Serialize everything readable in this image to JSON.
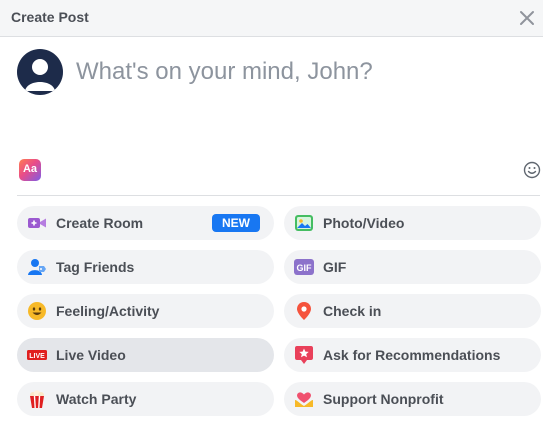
{
  "header": {
    "title": "Create Post"
  },
  "composer": {
    "prompt": "What's on your mind, John?"
  },
  "toolbar": {
    "text_style_label": "Aa"
  },
  "actions": [
    {
      "label": "Create Room",
      "icon": "video-camera-icon",
      "badge": "NEW"
    },
    {
      "label": "Photo/Video",
      "icon": "photo-icon"
    },
    {
      "label": "Tag Friends",
      "icon": "tag-friends-icon"
    },
    {
      "label": "GIF",
      "icon": "gif-icon"
    },
    {
      "label": "Feeling/Activity",
      "icon": "smiley-icon"
    },
    {
      "label": "Check in",
      "icon": "location-pin-icon"
    },
    {
      "label": "Live Video",
      "icon": "live-icon",
      "icon_text": "LIVE",
      "state": "hovered"
    },
    {
      "label": "Ask for Recommendations",
      "icon": "recommendations-icon"
    },
    {
      "label": "Watch Party",
      "icon": "popcorn-icon"
    },
    {
      "label": "Support Nonprofit",
      "icon": "heart-hands-icon"
    }
  ],
  "colors": {
    "accent": "#1877f2",
    "header_bg": "#f5f6f7",
    "action_bg": "#f2f3f5",
    "live_red": "#e02020"
  }
}
